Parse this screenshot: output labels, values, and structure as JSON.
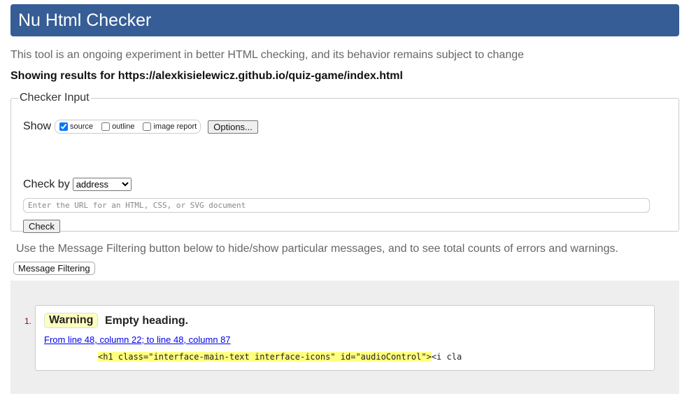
{
  "header": {
    "title": "Nu Html Checker"
  },
  "tagline": "This tool is an ongoing experiment in better HTML checking, and its behavior remains subject to change",
  "results_for": "Showing results for https://alexkisielewicz.github.io/quiz-game/index.html",
  "checker_input": {
    "legend": "Checker Input",
    "show_label": "Show",
    "options": [
      {
        "label": "source",
        "checked": true
      },
      {
        "label": "outline",
        "checked": false
      },
      {
        "label": "image report",
        "checked": false
      }
    ],
    "options_button": "Options...",
    "check_by_label": "Check by",
    "check_by_value": "address",
    "url_placeholder": "Enter the URL for an HTML, CSS, or SVG document",
    "url_value": "",
    "check_button": "Check"
  },
  "filtering": {
    "text": "Use the Message Filtering button below to hide/show particular messages, and to see total counts of errors and warnings.",
    "button": "Message Filtering"
  },
  "messages": [
    {
      "number": "1.",
      "type": "Warning",
      "text": "Empty heading.",
      "location": "From line 48, column 22; to line 48, column 87",
      "code_highlight": "<h1 class=\"interface-main-text interface-icons\" id=\"audioControl\">",
      "code_after": "<i cla"
    }
  ],
  "colors": {
    "header_bg": "#365d95",
    "warning_bg": "#ffffc0",
    "highlight": "#ffff80",
    "link": "#0000ee"
  }
}
